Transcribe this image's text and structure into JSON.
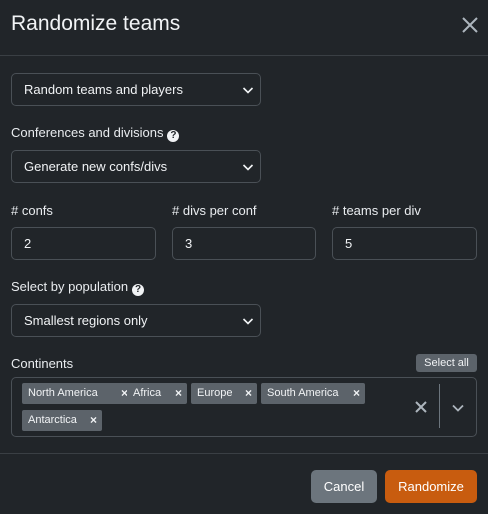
{
  "modal": {
    "title": "Randomize teams"
  },
  "mode_select": {
    "value": "Random teams and players"
  },
  "conferences": {
    "label": "Conferences and divisions",
    "help": "?",
    "value": "Generate new confs/divs"
  },
  "counts": {
    "confs_label": "# confs",
    "confs_value": "2",
    "divs_label": "# divs per conf",
    "divs_value": "3",
    "teams_label": "# teams per div",
    "teams_value": "5"
  },
  "population": {
    "label": "Select by population",
    "help": "?",
    "value": "Smallest regions only"
  },
  "continents": {
    "label": "Continents",
    "select_all": "Select all",
    "chips": [
      "North America",
      "Africa",
      "Europe",
      "South America",
      "Antarctica"
    ],
    "remove_symbol": "×"
  },
  "footer": {
    "cancel": "Cancel",
    "randomize": "Randomize"
  },
  "colors": {
    "background": "#212529",
    "accent": "#c85c0f",
    "secondary": "#6c757d"
  },
  "icons": {
    "close": "close-icon",
    "caret": "chevron-down-icon",
    "help": "question-circle-icon"
  }
}
